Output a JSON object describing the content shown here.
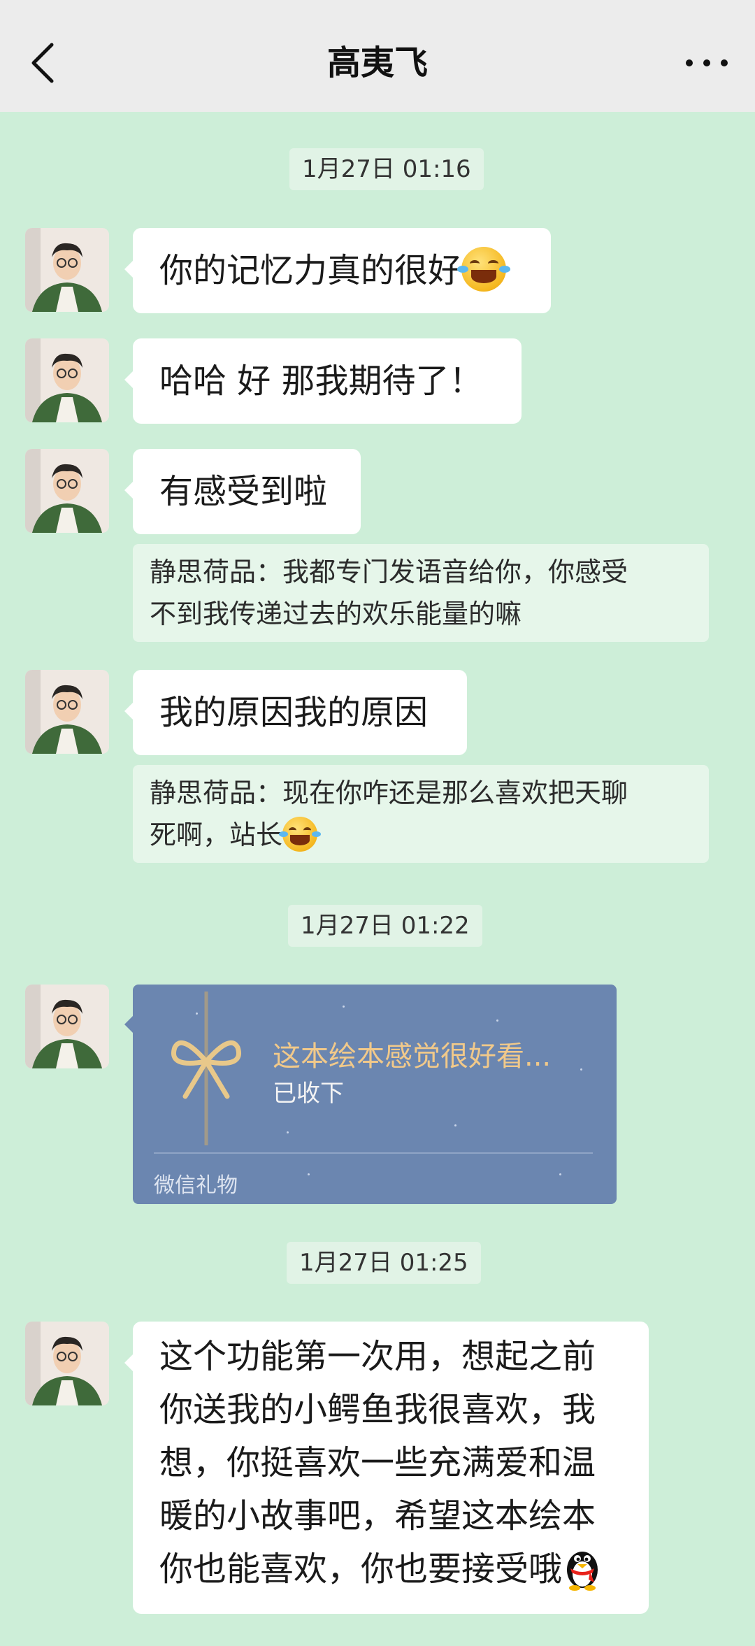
{
  "header": {
    "title": "高夷飞"
  },
  "timestamps": [
    "1月27日 01:16",
    "1月27日 01:22",
    "1月27日 01:25"
  ],
  "messages": [
    {
      "text": "你的记忆力真的很好",
      "emoji": "tears-of-joy"
    },
    {
      "text": "哈哈 好 那我期待了！"
    },
    {
      "text": "有感受到啦",
      "quote": {
        "line1": "静思荷品：我都专门发语音给你，你感受",
        "line2": "不到我传递过去的欢乐能量的嘛"
      }
    },
    {
      "text": "我的原因我的原因",
      "quote": {
        "line1": "静思荷品：现在你咋还是那么喜欢把天聊",
        "line2": "死啊，站长",
        "emoji": "tears-of-joy"
      }
    },
    {
      "lines": [
        "这个功能第一次用，想起之前",
        "你送我的小鳄鱼我很喜欢，我",
        "想，你挺喜欢一些充满爱和温",
        "暖的小故事吧，希望这本绘本",
        "你也能喜欢，你也要接受哦"
      ],
      "emoji": "penguin"
    }
  ],
  "gift": {
    "title": "这本绘本感觉很好看...",
    "status": "已收下",
    "footer": "微信礼物",
    "bg_color": "#6b86b0",
    "title_color": "#f1c98a"
  },
  "colors": {
    "chat_bg": "#cdeed8",
    "header_bg": "#ececec",
    "bubble_bg": "#ffffff"
  },
  "icons": [
    "back-icon",
    "more-icon",
    "avatar",
    "bow-icon"
  ]
}
